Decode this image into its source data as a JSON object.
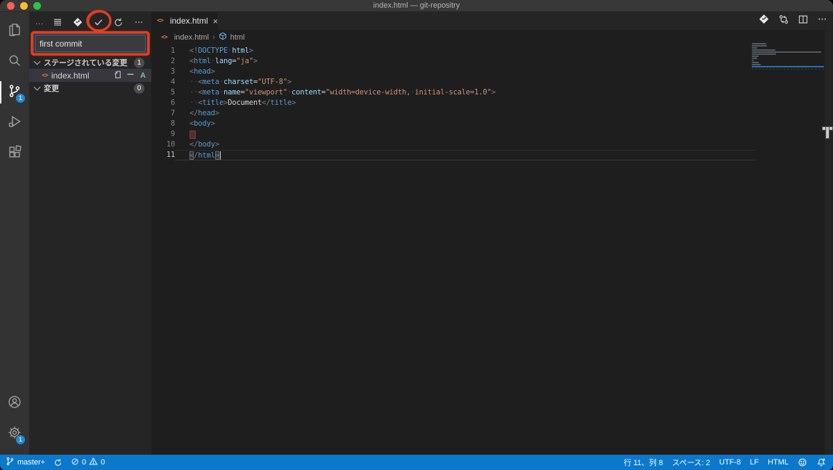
{
  "window": {
    "title": "index.html — git-repositry"
  },
  "activity_bar": {
    "items": [
      {
        "name": "explorer"
      },
      {
        "name": "search"
      },
      {
        "name": "source-control",
        "badge": "1",
        "active": true
      },
      {
        "name": "run-and-debug"
      },
      {
        "name": "extensions"
      }
    ],
    "bottom_items": [
      {
        "name": "accounts"
      },
      {
        "name": "manage-settings",
        "badge": "1"
      }
    ]
  },
  "scm": {
    "toolbar": {
      "title_overflow": "...",
      "icons": [
        "view-and-sort",
        "git-graph",
        "commit",
        "refresh",
        "more-actions"
      ]
    },
    "commit_input": {
      "value": "first commit"
    },
    "staged_section": {
      "label": "ステージされている変更",
      "badge": "1"
    },
    "staged_item": {
      "file": "index.html",
      "status": "A",
      "actions": [
        "open-file",
        "unstage-changes"
      ]
    },
    "changes_section": {
      "label": "変更",
      "badge": "0"
    }
  },
  "editor": {
    "tab": {
      "label": "index.html",
      "close": "×"
    },
    "breadcrumb": {
      "file": "index.html",
      "separator": "›",
      "symbol": "html"
    },
    "action_icons": [
      "git-commit",
      "open-changes",
      "split-editor",
      "more-actions"
    ],
    "code": {
      "lines": [
        {
          "num": "1",
          "tokens": [
            [
              "<!",
              "p"
            ],
            [
              "DOCTYPE",
              "tag"
            ],
            [
              " ",
              "sp"
            ],
            [
              "html",
              "attr"
            ],
            [
              ">",
              "p"
            ]
          ]
        },
        {
          "num": "2",
          "tokens": [
            [
              "<",
              "p"
            ],
            [
              "html",
              "tag"
            ],
            [
              " ",
              "sp"
            ],
            [
              "lang",
              "attr"
            ],
            [
              "=",
              "eq"
            ],
            [
              "\"ja\"",
              "str"
            ],
            [
              ">",
              "p"
            ]
          ]
        },
        {
          "num": "3",
          "tokens": [
            [
              "<",
              "p"
            ],
            [
              "head",
              "tag"
            ],
            [
              ">",
              "p"
            ]
          ]
        },
        {
          "num": "4",
          "tokens": [
            [
              "  ",
              "sp"
            ],
            [
              "<",
              "p"
            ],
            [
              "meta",
              "tag"
            ],
            [
              " ",
              "sp"
            ],
            [
              "charset",
              "attr"
            ],
            [
              "=",
              "eq"
            ],
            [
              "\"UTF-8\"",
              "str"
            ],
            [
              ">",
              "p"
            ]
          ]
        },
        {
          "num": "5",
          "tokens": [
            [
              "  ",
              "sp"
            ],
            [
              "<",
              "p"
            ],
            [
              "meta",
              "tag"
            ],
            [
              " ",
              "sp"
            ],
            [
              "name",
              "attr"
            ],
            [
              "=",
              "eq"
            ],
            [
              "\"viewport\"",
              "str"
            ],
            [
              " ",
              "sp"
            ],
            [
              "content",
              "attr"
            ],
            [
              "=",
              "eq"
            ],
            [
              "\"width=device-width, initial-scale=1.0\"",
              "str"
            ],
            [
              ">",
              "p"
            ]
          ]
        },
        {
          "num": "6",
          "tokens": [
            [
              "  ",
              "sp"
            ],
            [
              "<",
              "p"
            ],
            [
              "title",
              "tag"
            ],
            [
              ">",
              "p"
            ],
            [
              "Document",
              "txt"
            ],
            [
              "</",
              "p"
            ],
            [
              "title",
              "tag"
            ],
            [
              ">",
              "p"
            ]
          ]
        },
        {
          "num": "7",
          "tokens": [
            [
              "</",
              "p"
            ],
            [
              "head",
              "tag"
            ],
            [
              ">",
              "p"
            ]
          ]
        },
        {
          "num": "8",
          "tokens": [
            [
              "<",
              "p"
            ],
            [
              "body",
              "tag"
            ],
            [
              ">",
              "p"
            ]
          ]
        },
        {
          "num": "9",
          "tokens": [
            [
              "",
              "tws"
            ]
          ]
        },
        {
          "num": "10",
          "tokens": [
            [
              "</",
              "p"
            ],
            [
              "body",
              "tag"
            ],
            [
              ">",
              "p"
            ]
          ]
        },
        {
          "num": "11",
          "tokens": [
            [
              "<",
              "pbm"
            ],
            [
              "/",
              "p"
            ],
            [
              "html",
              "tag"
            ],
            [
              ">",
              "pbm"
            ],
            [
              "",
              "caret"
            ]
          ],
          "current": true
        }
      ]
    }
  },
  "status_bar": {
    "branch": "master+",
    "errors": "0",
    "warnings": "0",
    "line_col": "行 11、列 8",
    "indent": "スペース: 2",
    "encoding": "UTF-8",
    "eol": "LF",
    "language": "HTML"
  },
  "colors": {
    "accent": "#007acc",
    "annotation_red": "#e2401d",
    "added_green": "#73c991",
    "html_icon_orange": "#e37933",
    "badge_bg": "#4d4d4d"
  }
}
